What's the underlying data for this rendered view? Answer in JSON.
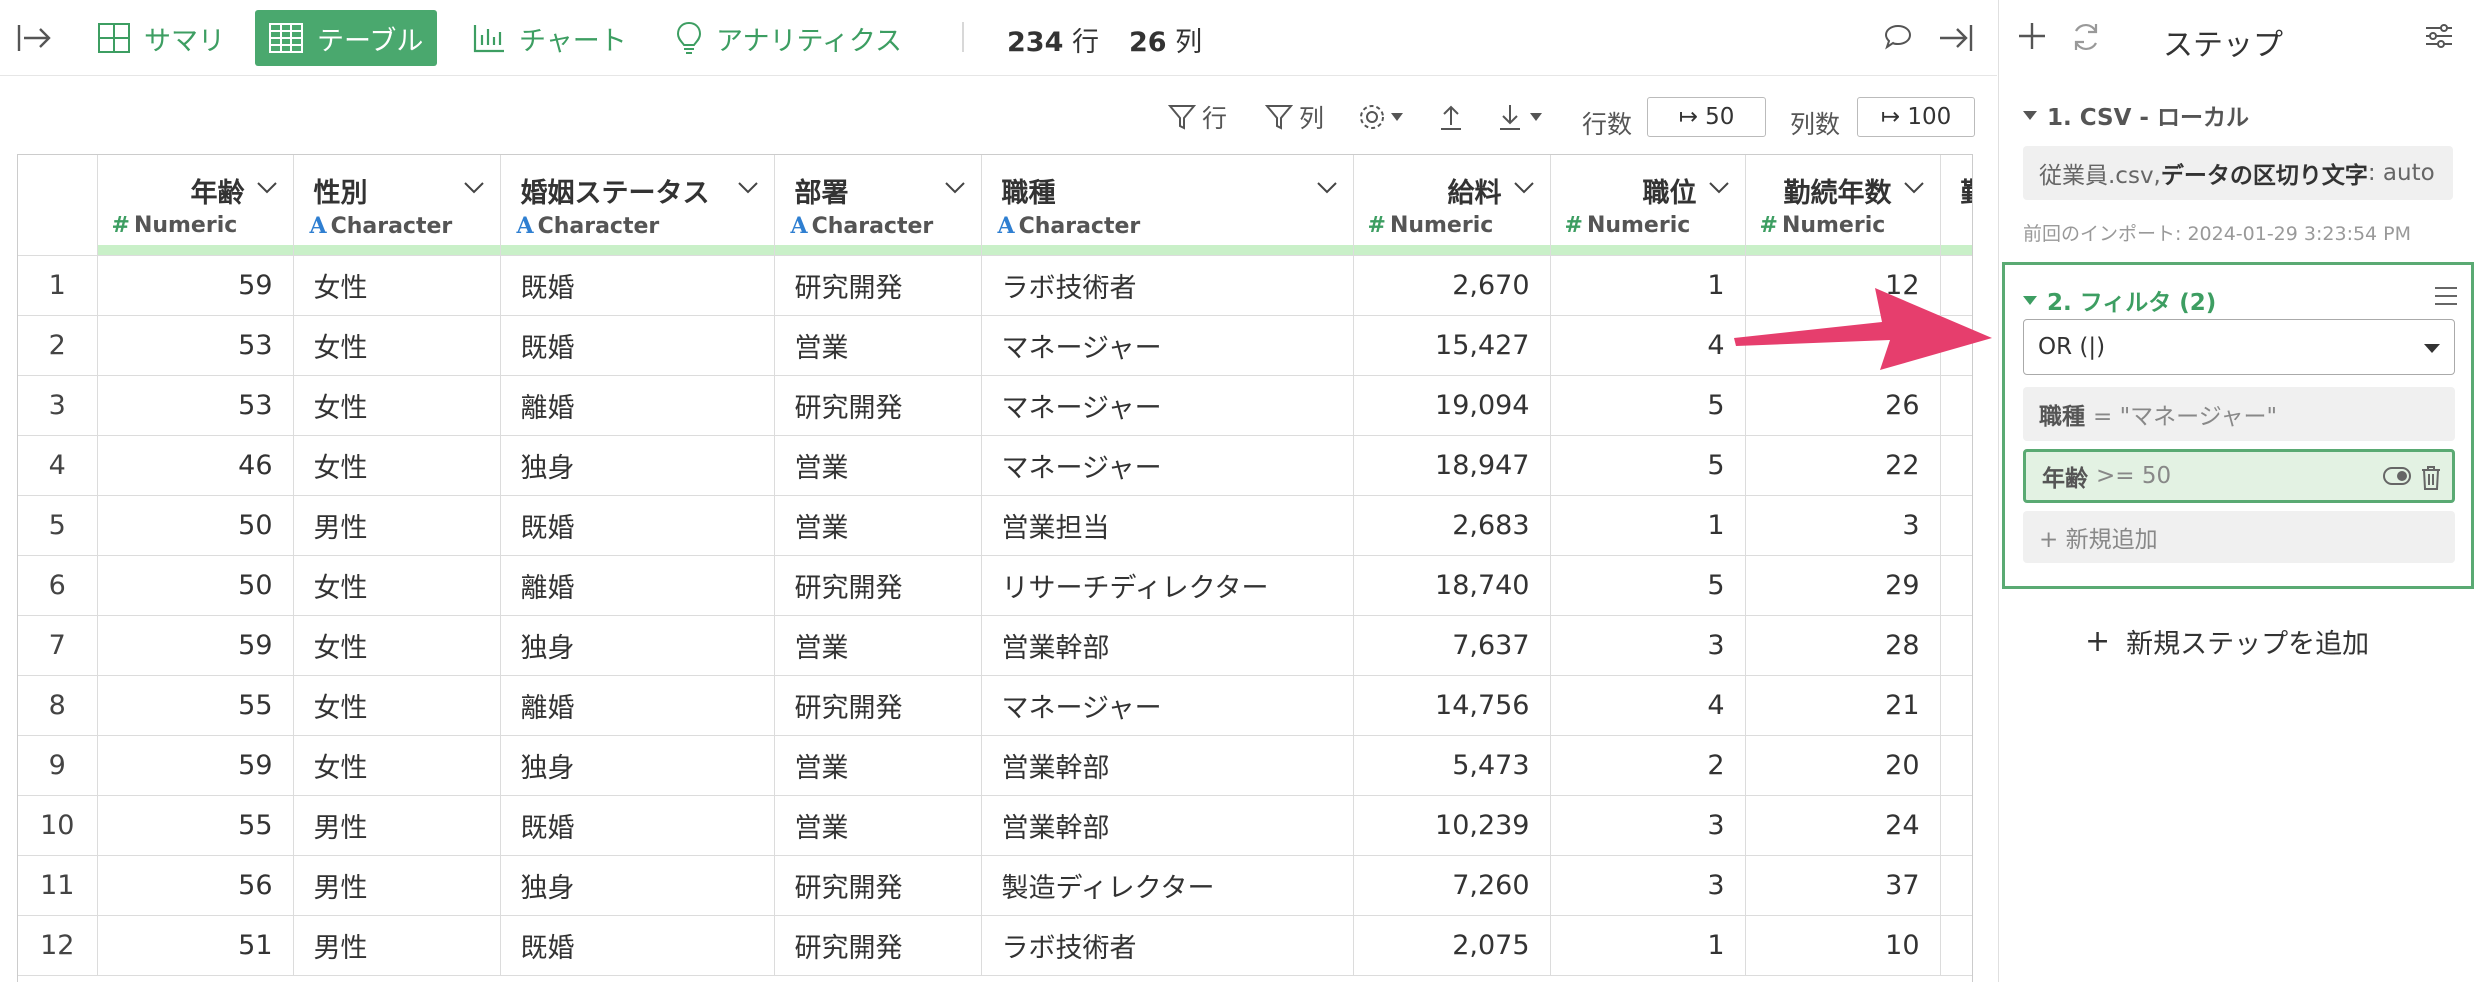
{
  "tabs": {
    "summary": "サマリ",
    "table": "テーブル",
    "chart": "チャート",
    "analytics": "アナリティクス"
  },
  "counts": {
    "rows_value": "234",
    "rows_unit": "行",
    "cols_value": "26",
    "cols_unit": "列"
  },
  "toolbar": {
    "filter_row": "行",
    "filter_col": "列",
    "rows_label": "行数",
    "rows_value": "↦ 50",
    "cols_label": "列数",
    "cols_value": "↦ 100"
  },
  "table": {
    "columns": [
      {
        "name": "年齢",
        "type": "Numeric"
      },
      {
        "name": "性別",
        "type": "Character"
      },
      {
        "name": "婚姻ステータス",
        "type": "Character"
      },
      {
        "name": "部署",
        "type": "Character"
      },
      {
        "name": "職種",
        "type": "Character"
      },
      {
        "name": "給料",
        "type": "Numeric"
      },
      {
        "name": "職位",
        "type": "Numeric"
      },
      {
        "name": "勤続年数",
        "type": "Numeric"
      },
      {
        "name": "勤",
        "type": ""
      }
    ],
    "rows": [
      [
        "1",
        "59",
        "女性",
        "既婚",
        "研究開発",
        "ラボ技術者",
        "2,670",
        "1",
        "12"
      ],
      [
        "2",
        "53",
        "女性",
        "既婚",
        "営業",
        "マネージャー",
        "15,427",
        "4",
        ""
      ],
      [
        "3",
        "53",
        "女性",
        "離婚",
        "研究開発",
        "マネージャー",
        "19,094",
        "5",
        "26"
      ],
      [
        "4",
        "46",
        "女性",
        "独身",
        "営業",
        "マネージャー",
        "18,947",
        "5",
        "22"
      ],
      [
        "5",
        "50",
        "男性",
        "既婚",
        "営業",
        "営業担当",
        "2,683",
        "1",
        "3"
      ],
      [
        "6",
        "50",
        "女性",
        "離婚",
        "研究開発",
        "リサーチディレクター",
        "18,740",
        "5",
        "29"
      ],
      [
        "7",
        "59",
        "女性",
        "独身",
        "営業",
        "営業幹部",
        "7,637",
        "3",
        "28"
      ],
      [
        "8",
        "55",
        "女性",
        "離婚",
        "研究開発",
        "マネージャー",
        "14,756",
        "4",
        "21"
      ],
      [
        "9",
        "59",
        "女性",
        "独身",
        "営業",
        "営業幹部",
        "5,473",
        "2",
        "20"
      ],
      [
        "10",
        "55",
        "男性",
        "既婚",
        "営業",
        "営業幹部",
        "10,239",
        "3",
        "24"
      ],
      [
        "11",
        "56",
        "男性",
        "独身",
        "研究開発",
        "製造ディレクター",
        "7,260",
        "3",
        "37"
      ],
      [
        "12",
        "51",
        "男性",
        "既婚",
        "研究開発",
        "ラボ技術者",
        "2,075",
        "1",
        "10"
      ]
    ]
  },
  "panel": {
    "title": "ステップ",
    "step1": {
      "title": "1. CSV - ローカル",
      "file": "従業員.csv, ",
      "delim_label": "データの区切り文字",
      "delim_value": ": auto",
      "meta": "前回のインポート: 2024-01-29 3:23:54 PM"
    },
    "step2": {
      "title": "2. フィルタ (2)",
      "operator": "OR (|)",
      "cond1_field": "職種",
      "cond1_expr": "= \"マネージャー\"",
      "cond2_field": "年齢",
      "cond2_expr": ">= 50",
      "add_new": "+ 新規追加"
    },
    "add_step": "新規ステップを追加"
  },
  "colors": {
    "accent": "#4aa86e",
    "arrow": "#e63e6d",
    "header_bar": "#c9f0c8"
  }
}
